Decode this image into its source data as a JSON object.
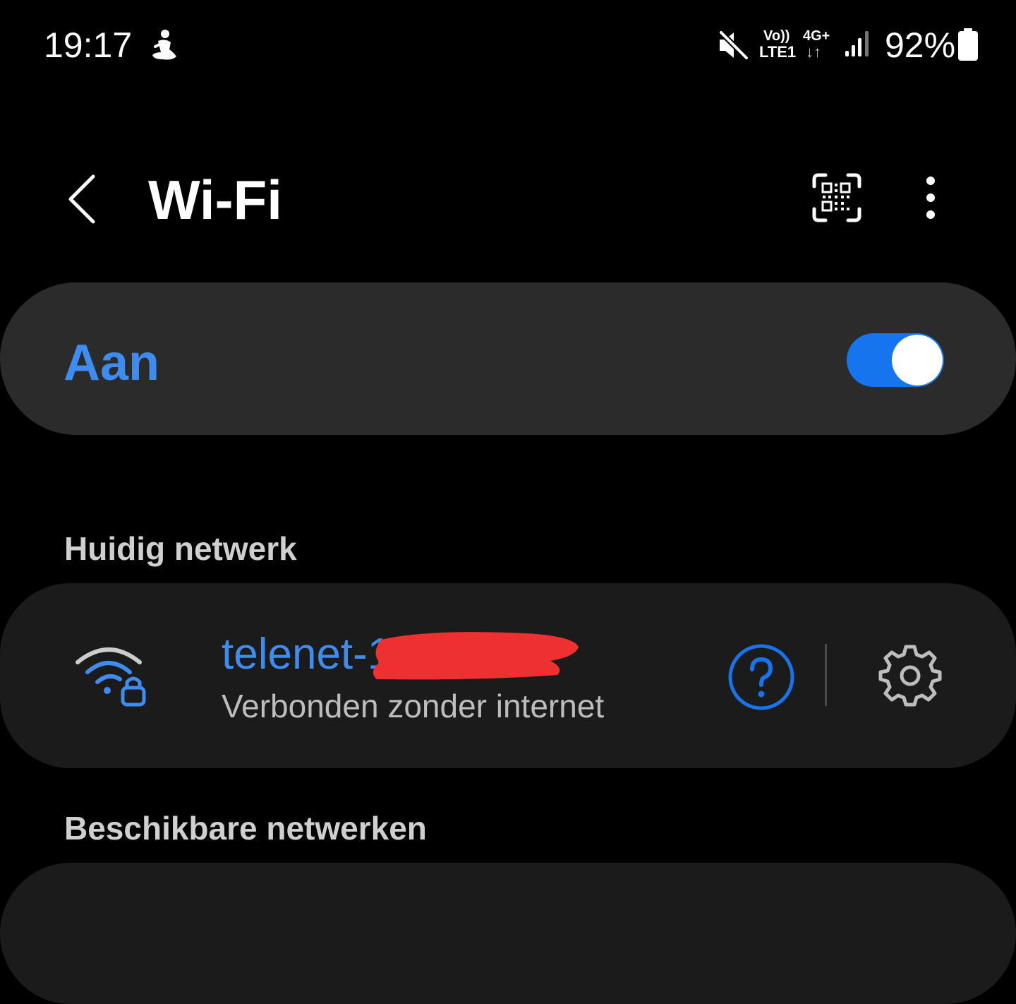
{
  "status_bar": {
    "time": "19:17",
    "volte_top": "Vo))",
    "volte_bottom": "LTE1",
    "network_type": "4G+",
    "data_arrows": "↓↑",
    "battery_percent": "92%",
    "icons": [
      "person-icon",
      "mute-icon",
      "signal-icon",
      "battery-icon"
    ]
  },
  "header": {
    "title": "Wi-Fi",
    "icons": [
      "back-icon",
      "qr-scan-icon",
      "more-options-icon"
    ]
  },
  "wifi_toggle": {
    "label": "Aan",
    "enabled": true
  },
  "current_network": {
    "section_title": "Huidig netwerk",
    "name_visible": "telenet-1",
    "status": "Verbonden zonder internet",
    "icons": [
      "wifi-locked-icon",
      "help-icon",
      "settings-gear-icon"
    ]
  },
  "available_networks": {
    "section_title": "Beschikbare netwerken"
  },
  "colors": {
    "background": "#000000",
    "card": "#2b2b2b",
    "network_card": "#1b1b1b",
    "accent": "#3f8cf0",
    "toggle_track": "#1675ee",
    "redaction": "#ef3030"
  }
}
